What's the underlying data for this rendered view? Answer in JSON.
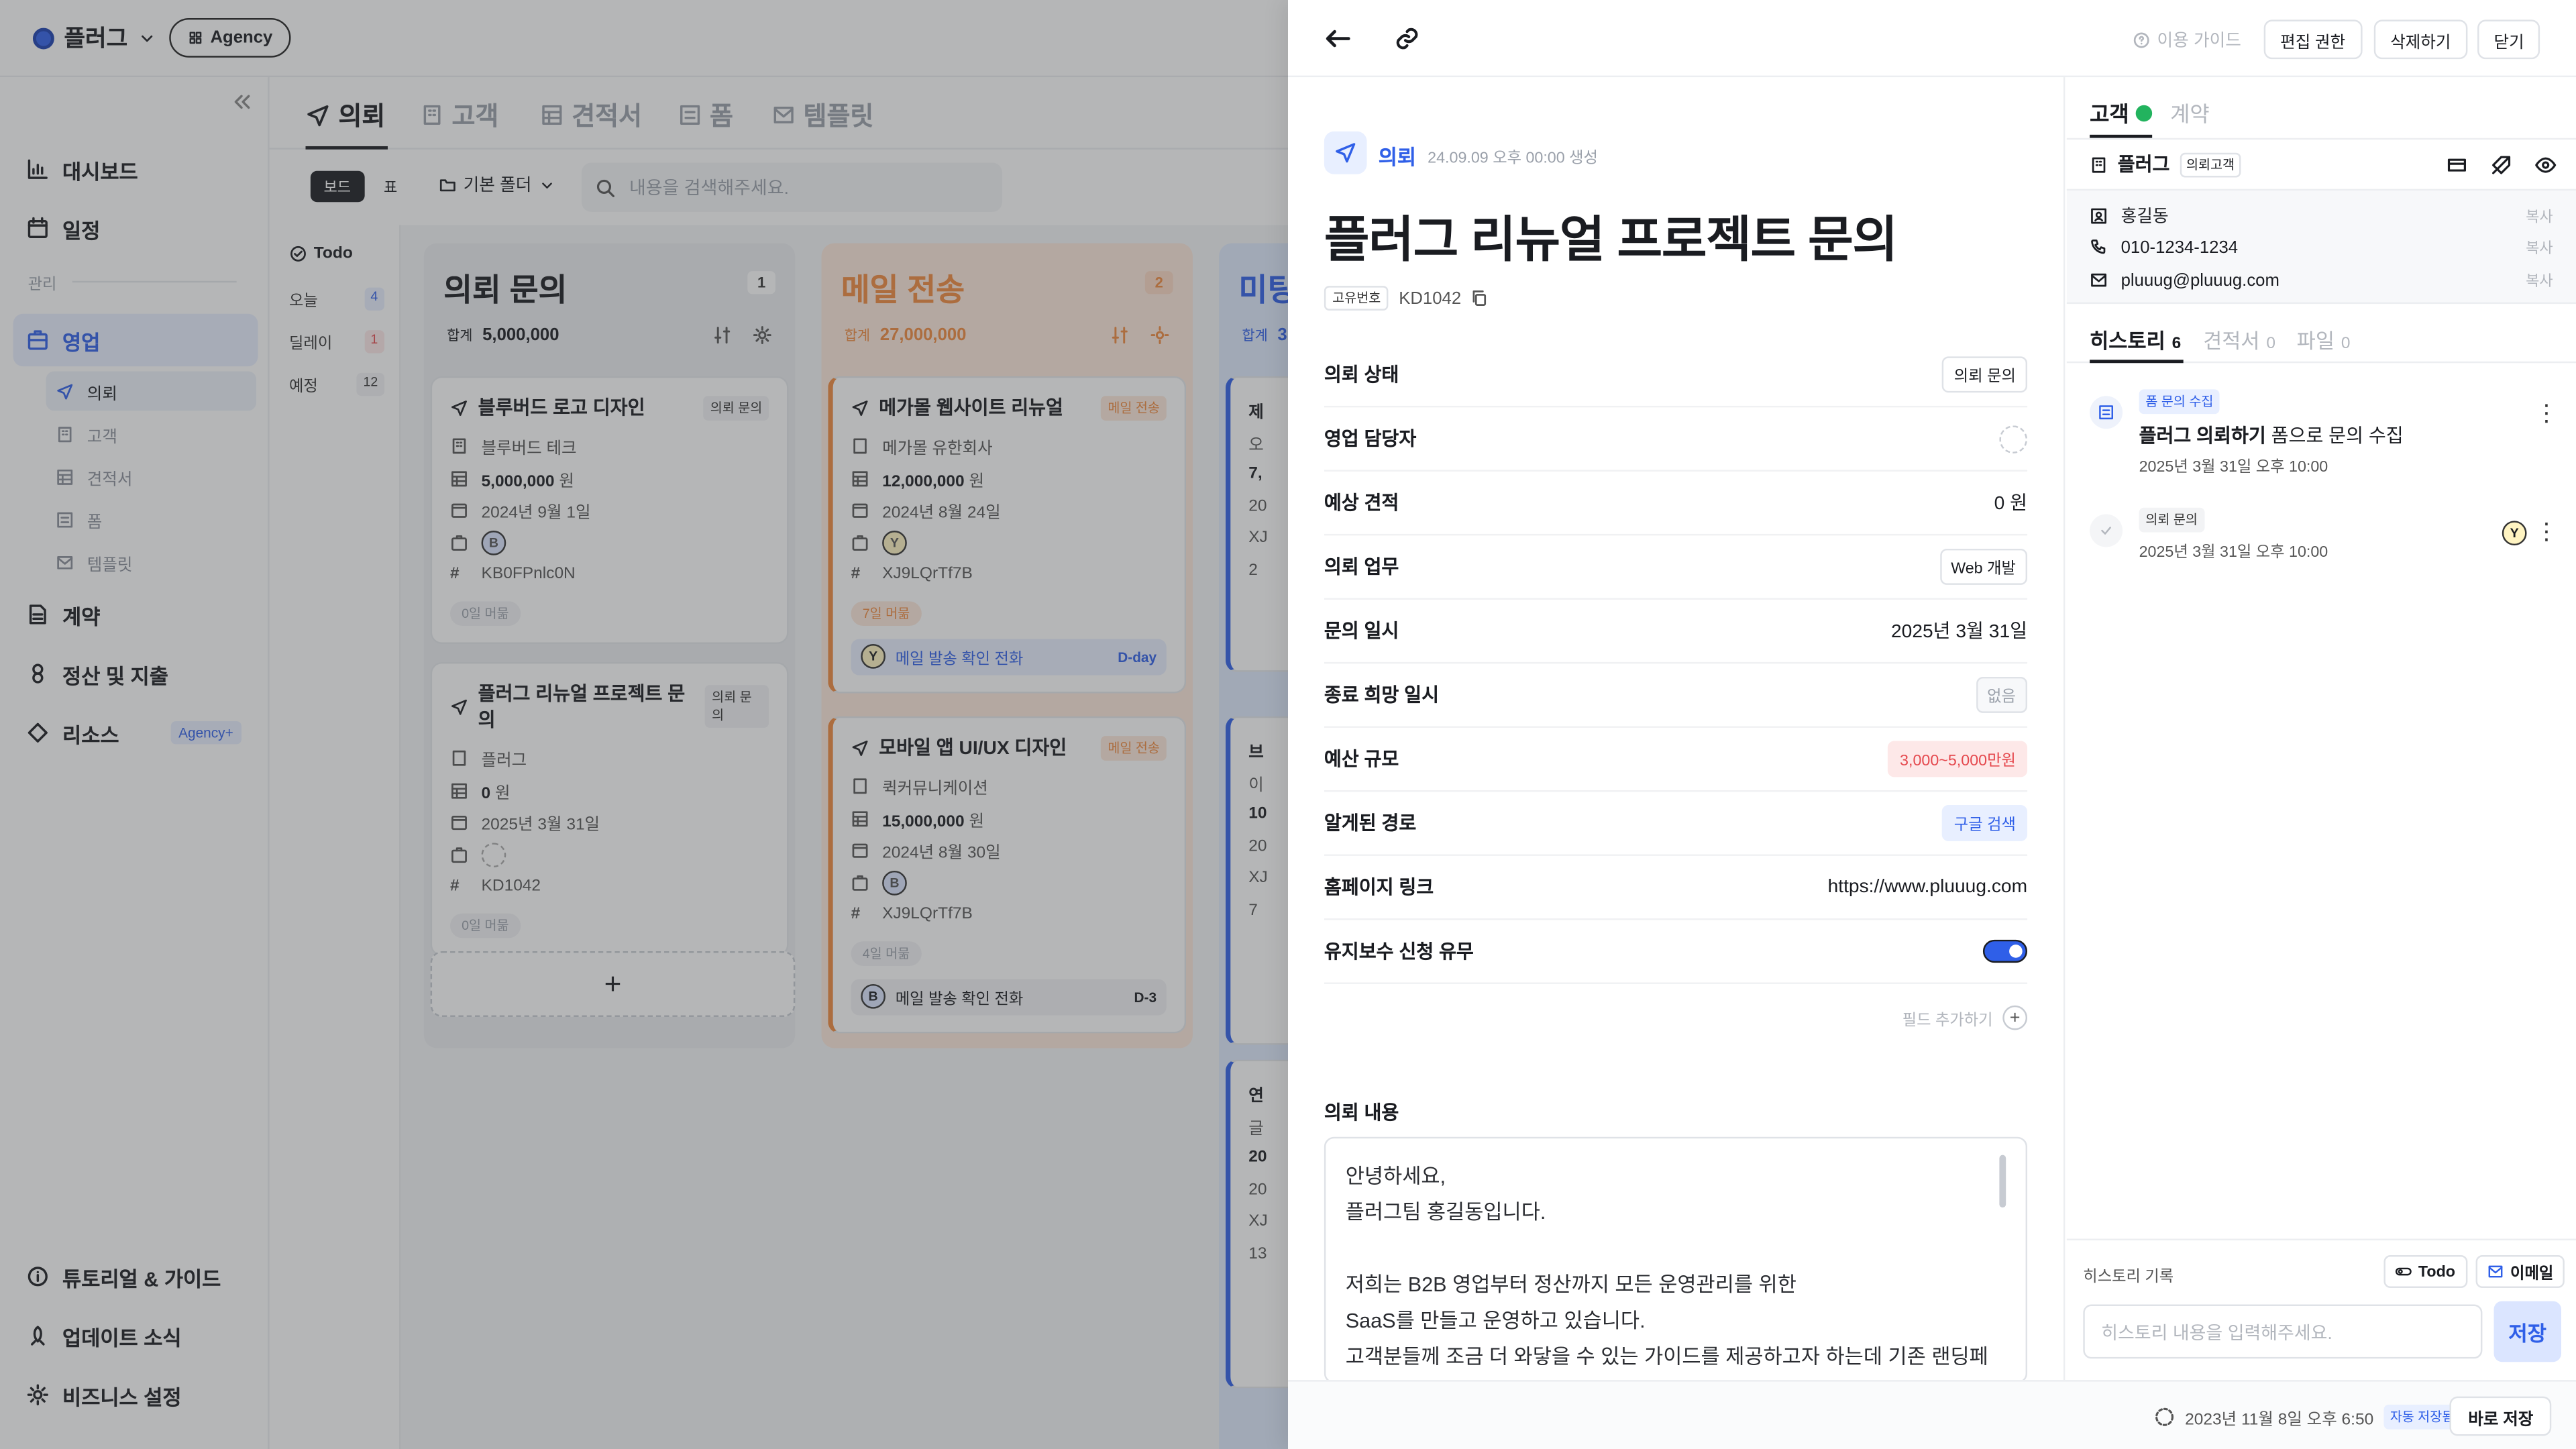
{
  "workspace": {
    "name": "플러그",
    "plan": "Agency"
  },
  "sidebar": {
    "items": {
      "dashboard": "대시보드",
      "schedule": "일정",
      "manage_section": "관리",
      "sales": "영업",
      "contract": "계약",
      "settlement": "정산 및 지출",
      "resource": "리소스",
      "resource_badge": "Agency+",
      "tutorial": "튜토리얼 & 가이드",
      "updates": "업데이트 소식",
      "business": "비즈니스 설정"
    },
    "sub": [
      "의뢰",
      "고객",
      "견적서",
      "폼",
      "템플릿"
    ]
  },
  "main": {
    "tabs": [
      "의뢰",
      "고객",
      "견적서",
      "폼",
      "템플릿"
    ],
    "view": {
      "board": "보드",
      "table": "표"
    },
    "folder": "기본 폴더",
    "search_placeholder": "내용을 검색해주세요.",
    "filters": {
      "title": "Todo",
      "rows": [
        {
          "label": "오늘",
          "count": "4"
        },
        {
          "label": "딜레이",
          "count": "1"
        },
        {
          "label": "예정",
          "count": "12"
        }
      ]
    },
    "sum_label": "합계",
    "columns": [
      {
        "title": "의뢰 문의",
        "count": "1",
        "sum": "5,000,000",
        "cards": [
          {
            "title": "블루버드 로고 디자인",
            "tag": "의뢰 문의",
            "client": "블루버드 테크",
            "amount": "5,000,000",
            "unit": "원",
            "date": "2024년 9월 1일",
            "avatar": "B",
            "code": "KB0FPnlc0N",
            "stay": "0일 머묾"
          },
          {
            "title": "플러그 리뉴얼 프로젝트 문의",
            "tag": "의뢰 문의",
            "client": "플러그",
            "amount": "0",
            "unit": "원",
            "date": "2025년 3월 31일",
            "avatar": "",
            "code": "KD1042",
            "stay": "0일 머묾"
          }
        ]
      },
      {
        "title": "메일 전송",
        "count": "2",
        "sum": "27,000,000",
        "cards": [
          {
            "title": "메가몰 웹사이트 리뉴얼",
            "tag": "메일 전송",
            "client": "메가몰 유한회사",
            "amount": "12,000,000",
            "unit": "원",
            "date": "2024년 8월 24일",
            "avatar": "Y",
            "code": "XJ9LQrTf7B",
            "stay": "7일 머묾",
            "action": "메일 발송 확인 전화",
            "action_avatar": "Y",
            "dday": "D-day"
          },
          {
            "title": "모바일 앱 UI/UX 디자인",
            "tag": "메일 전송",
            "client": "퀵커뮤니케이션",
            "amount": "15,000,000",
            "unit": "원",
            "date": "2024년 8월 30일",
            "avatar": "B",
            "code": "XJ9LQrTf7B",
            "stay": "4일 머묾",
            "action": "메일 발송 확인 전화",
            "action_avatar": "B",
            "dday": "D-3"
          }
        ]
      },
      {
        "title": "미팅",
        "count": "",
        "sum": "3",
        "partial": [
          "제",
          "오",
          "7,",
          "20",
          "XJ",
          "2",
          "브",
          "이",
          "10",
          "20",
          "XJ",
          "7",
          "연",
          "글",
          "20",
          "20",
          "XJ",
          "13"
        ]
      }
    ]
  },
  "panel": {
    "guide": "이용 가이드",
    "buttons": {
      "edit": "편집 권한",
      "delete": "삭제하기",
      "close": "닫기"
    },
    "type": "의뢰",
    "created": "24.09.09 오후 00:00 생성",
    "title": "플러그 리뉴얼 프로젝트 문의",
    "uid_label": "고유번호",
    "uid": "KD1042",
    "fields": [
      {
        "label": "의뢰 상태",
        "value": "의뢰 문의",
        "kind": "chip"
      },
      {
        "label": "영업 담당자",
        "value": "",
        "kind": "avatar"
      },
      {
        "label": "예상 견적",
        "value": "0 원",
        "kind": "text"
      },
      {
        "label": "의뢰 업무",
        "value": "Web 개발",
        "kind": "chip"
      },
      {
        "label": "문의 일시",
        "value": "2025년 3월 31일",
        "kind": "text"
      },
      {
        "label": "종료 희망 일시",
        "value": "없음",
        "kind": "muted"
      },
      {
        "label": "예산 규모",
        "value": "3,000~5,000만원",
        "kind": "red"
      },
      {
        "label": "알게된 경로",
        "value": "구글 검색",
        "kind": "blue"
      },
      {
        "label": "홈페이지 링크",
        "value": "https://www.pluuug.com",
        "kind": "text"
      },
      {
        "label": "유지보수 신청 유무",
        "value": "",
        "kind": "toggle"
      }
    ],
    "add_field": "필드 추가하기",
    "content_label": "의뢰 내용",
    "content": "안녕하세요,\n플러그팀 홍길동입니다.\n\n저희는 B2B 영업부터 정산까지 모든 운영관리를 위한\nSaaS를 만들고 운영하고 있습니다.\n고객분들께 조금 더 와닿을 수 있는 가이드를 제공하고자 하는데 기존 랜딩페",
    "right": {
      "tabs": {
        "customer": "고객",
        "contract": "계약"
      },
      "customer_name": "플러그",
      "customer_tag": "의뢰고객",
      "contact": {
        "name": "홍길동",
        "phone": "010-1234-1234",
        "email": "pluuug@pluuug.com",
        "copy": "복사"
      },
      "htabs": [
        {
          "label": "히스토리",
          "count": "6"
        },
        {
          "label": "견적서",
          "count": "0"
        },
        {
          "label": "파일",
          "count": "0"
        }
      ],
      "history": [
        {
          "tag": "폼 문의 수집",
          "bold": "플러그 의뢰하기",
          "rest": " 폼으로 문의 수집",
          "date": "2025년 3월 31일 오후 10:00"
        },
        {
          "tag": "의뢰 문의",
          "date": "2025년 3월 31일 오후 10:00",
          "avatar": "Y"
        }
      ],
      "record_label": "히스토리 기록",
      "todo": "Todo",
      "email": "이메일",
      "record_placeholder": "히스토리 내용을 입력해주세요.",
      "save": "저장"
    },
    "footer": {
      "time": "2023년 11월 8일 오후 6:50",
      "autosave": "자동 저장됨",
      "save_now": "바로 저장"
    }
  },
  "colors": {
    "accent": "#2f5fe8",
    "orange": "#f08a3e",
    "red": "#e5484d"
  }
}
